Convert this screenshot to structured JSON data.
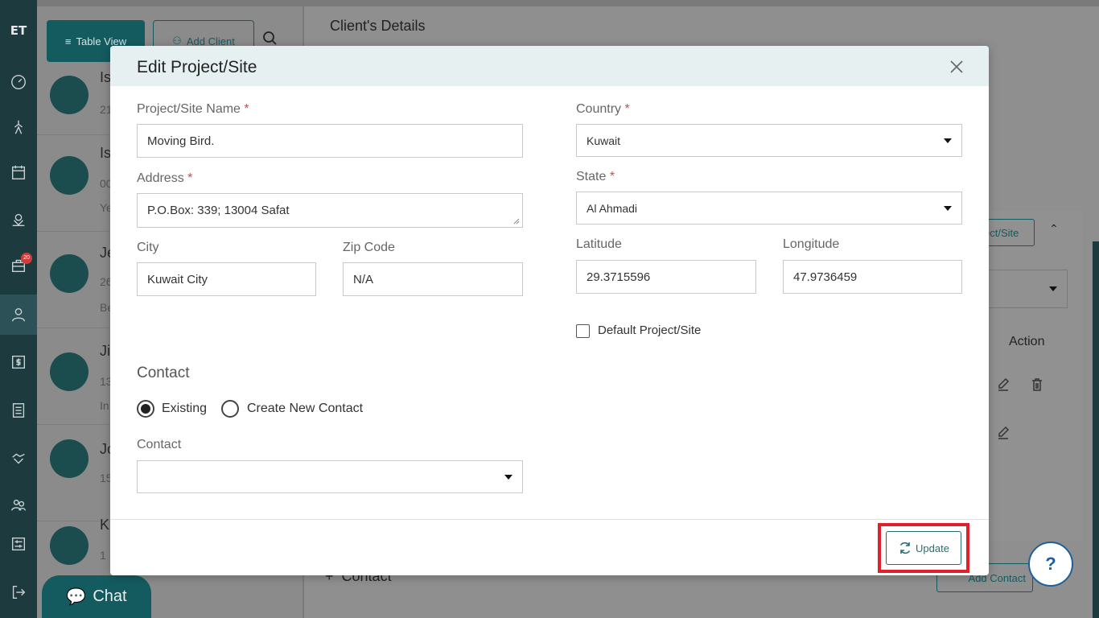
{
  "rail": {
    "logo": "ET",
    "badge_count": "20",
    "icons": [
      "dashboard-icon",
      "tools-icon",
      "calendar-icon",
      "location-icon",
      "briefcase-icon",
      "clients-icon",
      "invoice-icon",
      "list-icon",
      "handshake-icon",
      "users-icon",
      "settings-icon",
      "logout-icon"
    ]
  },
  "list_panel": {
    "table_view_label": "Table View",
    "add_client_label": "Add Client",
    "rows": [
      {
        "name": "Is",
        "sub1": "21"
      },
      {
        "name": "Is",
        "sub1": "00",
        "sub2": "Ye"
      },
      {
        "name": "Je",
        "sub1": "26",
        "sub2": "Be"
      },
      {
        "name": "Ji",
        "sub1": "13",
        "sub2": "In"
      },
      {
        "name": "Jo",
        "sub1": "15"
      },
      {
        "name": "K",
        "sub1": "1"
      }
    ],
    "chat_label": "Chat"
  },
  "details_panel": {
    "title": "Client's Details",
    "project_site_button": "ect/Site",
    "action_header": "Action",
    "contact_section": "Contact",
    "add_contact_label": "Add Contact",
    "help_label": "?"
  },
  "modal": {
    "title": "Edit Project/Site",
    "project_name": {
      "label": "Project/Site Name",
      "value": "Moving Bird."
    },
    "address": {
      "label": "Address",
      "value": "P.O.Box: 339; 13004 Safat"
    },
    "city": {
      "label": "City",
      "value": "Kuwait City"
    },
    "zip": {
      "label": "Zip Code",
      "value": "N/A"
    },
    "country": {
      "label": "Country",
      "value": "Kuwait"
    },
    "state": {
      "label": "State",
      "value": "Al Ahmadi"
    },
    "latitude": {
      "label": "Latitude",
      "value": "29.3715596"
    },
    "longitude": {
      "label": "Longitude",
      "value": "47.9736459"
    },
    "default_checkbox_label": "Default Project/Site",
    "contact_section_title": "Contact",
    "radio_existing": "Existing",
    "radio_new": "Create New Contact",
    "contact_field_label": "Contact",
    "contact_value": "",
    "update_label": "Update",
    "required_marker": "*"
  }
}
